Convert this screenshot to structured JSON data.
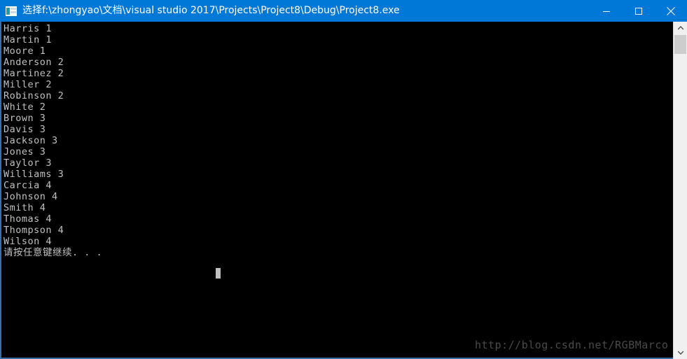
{
  "window": {
    "title": "选择f:\\zhongyao\\文档\\visual studio 2017\\Projects\\Project8\\Debug\\Project8.exe",
    "icon": "console-window-icon",
    "controls": {
      "minimize": "minimize-icon",
      "maximize": "maximize-icon",
      "close": "close-icon"
    },
    "titlebar_color": "#0078d7",
    "border_color": "#3a6ea5"
  },
  "console": {
    "background_color": "#000000",
    "text_color": "#c0c0c0",
    "lines": [
      "Harris 1",
      "Martin 1",
      "Moore 1",
      "Anderson 2",
      "Martinez 2",
      "Miller 2",
      "Robinson 2",
      "White 2",
      "Brown 3",
      "Davis 3",
      "Jackson 3",
      "Jones 3",
      "Taylor 3",
      "Williams 3",
      "Carcia 4",
      "Johnson 4",
      "Smith 4",
      "Thomas 4",
      "Thompson 4",
      "Wilson 4",
      "请按任意键继续. . ."
    ],
    "cursor": "text-cursor-block"
  },
  "watermark": {
    "text": "http://blog.csdn.net/RGBMarco",
    "color": "#4a4a4a"
  },
  "scrollbar": {
    "up_arrow": "chevron-up-icon",
    "down_arrow": "chevron-down-icon",
    "thumb": "scrollbar-thumb",
    "track_color": "#f0f0f0",
    "thumb_color": "#cdcdcd"
  }
}
